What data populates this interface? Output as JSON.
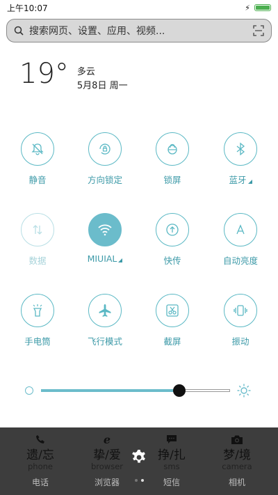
{
  "status_bar": {
    "time": "上午10:07",
    "charging_icon": "bolt-icon",
    "battery_icon": "battery-icon",
    "battery_level": 1.0
  },
  "search": {
    "placeholder": "搜索网页、设置、应用、视频...",
    "search_icon": "search-icon",
    "scan_icon": "scan-icon"
  },
  "weather": {
    "temperature": "19°",
    "condition": "多云",
    "date": "5月8日 周一"
  },
  "toggles": [
    {
      "label": "静音",
      "icon": "bell-off-icon",
      "state": "off"
    },
    {
      "label": "方向锁定",
      "icon": "rotation-lock-icon",
      "state": "off"
    },
    {
      "label": "锁屏",
      "icon": "lock-icon",
      "state": "off"
    },
    {
      "label": "蓝牙",
      "icon": "bluetooth-icon",
      "state": "off",
      "has_submenu": true
    },
    {
      "label": "数据",
      "icon": "mobile-data-icon",
      "state": "disabled"
    },
    {
      "label": "MIUIAL",
      "icon": "wifi-icon",
      "state": "on",
      "has_submenu": true
    },
    {
      "label": "快传",
      "icon": "share-icon",
      "state": "off"
    },
    {
      "label": "自动亮度",
      "icon": "auto-brightness-icon",
      "state": "off"
    },
    {
      "label": "手电筒",
      "icon": "flashlight-icon",
      "state": "off"
    },
    {
      "label": "飞行模式",
      "icon": "airplane-icon",
      "state": "off"
    },
    {
      "label": "截屏",
      "icon": "screenshot-icon",
      "state": "off"
    },
    {
      "label": "振动",
      "icon": "vibrate-icon",
      "state": "off"
    }
  ],
  "brightness": {
    "level": 0.73,
    "accent": "#6bbccb"
  },
  "dock": {
    "apps": [
      {
        "icon": "phone-icon",
        "cn": "遗/忘",
        "en": "phone",
        "label": "电话"
      },
      {
        "icon": "browser-icon",
        "cn": "挚/爱",
        "en": "browser",
        "label": "浏览器"
      },
      {
        "icon": "sms-icon",
        "cn": "挣/扎",
        "en": "sms",
        "label": "短信"
      },
      {
        "icon": "camera-icon",
        "cn": "梦/境",
        "en": "camera",
        "label": "相机"
      }
    ],
    "settings_icon": "gear-icon",
    "page_count": 2,
    "current_page": 2
  },
  "colors": {
    "accent": "#6bbccb",
    "label": "#3d9aa8",
    "dock_bg": "#3d3d3d"
  }
}
